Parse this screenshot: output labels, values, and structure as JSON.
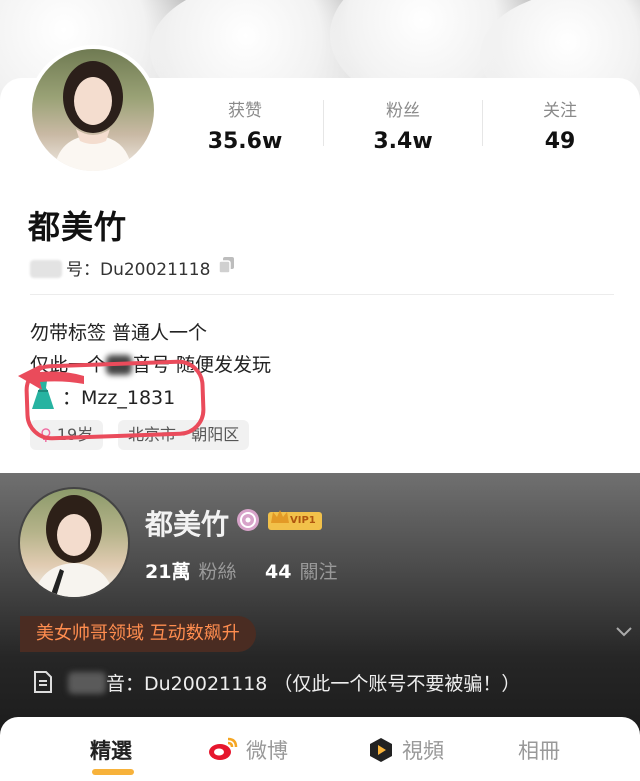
{
  "douyin": {
    "stats": [
      {
        "label": "获赞",
        "value": "35.6w"
      },
      {
        "label": "粉丝",
        "value": "3.4w"
      },
      {
        "label": "关注",
        "value": "49"
      }
    ],
    "name": "都美竹",
    "id_text": "号：Du20021118",
    "bio_line1": "勿带标签 普通人一个",
    "bio_line2_pre": "仅此一个",
    "bio_line2_post": "音号 随便发发玩",
    "dress_sep": "：",
    "handle": "Mzz_1831",
    "tags": [
      "19岁",
      "北京市 · 朝阳区"
    ]
  },
  "weibo": {
    "name": "都美竹",
    "vip_label": "VIP1",
    "followers_num": "21萬",
    "followers_label": "粉絲",
    "following_num": "44",
    "following_label": "關注",
    "slogan": "美女帅哥领域 互动数飙升",
    "desc_text": "音：Du20021118 （仅此一个账号不要被骗！）",
    "tabs": [
      "精選",
      "微博",
      "視頻",
      "相冊"
    ]
  },
  "colors": {
    "circle": "#ea4b5b",
    "slogan_text": "#ff8d4f",
    "vip_gold": "#f2c14a",
    "tab_underline": "#f7b23b"
  }
}
